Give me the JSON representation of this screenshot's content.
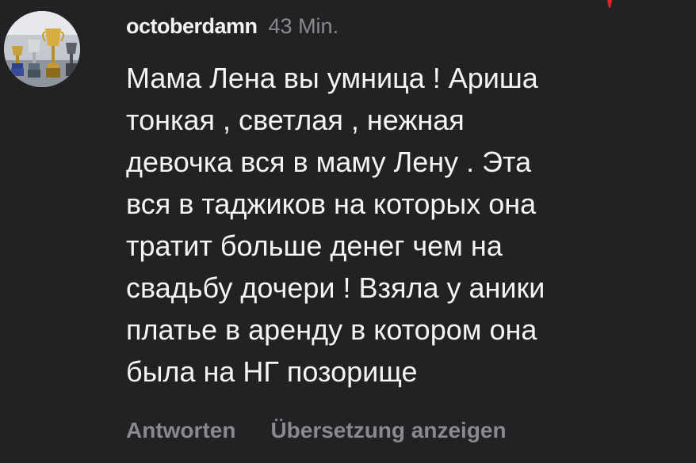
{
  "comment": {
    "username": "octoberdamn",
    "time": "43 Min.",
    "text": "Мама Лена вы умница ! Ариша\nтонкая , светлая , нежная\nдевочка вся в маму Лену . Эта\nвся в таджиков на которых она\nтратит больше денег чем на\nсвадьбу дочери ! Взяла у аники\nплатье в аренду в котором она\nбыла на НГ позорище",
    "avatar_icon": "trophy-cups-avatar"
  },
  "actions": {
    "reply_label": "Antworten",
    "translate_label": "Übersetzung anzeigen"
  },
  "colors": {
    "background": "#222225",
    "primary_text": "#f2f2f2",
    "secondary_text": "#8a8a8e",
    "accent_mark": "#e0242a"
  }
}
